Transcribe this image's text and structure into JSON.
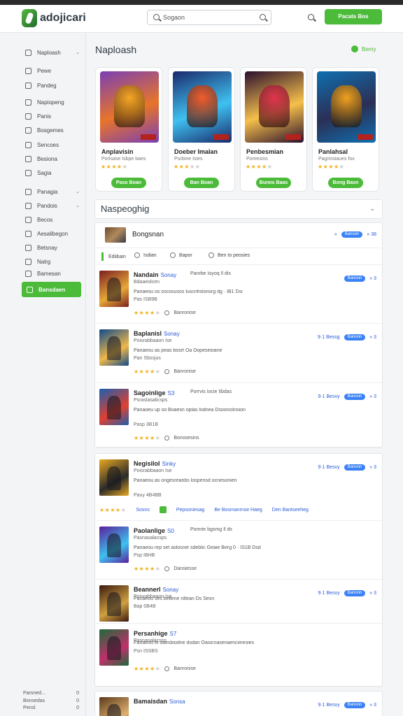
{
  "header": {
    "app_name": "adojicari",
    "search_placeholder": "Sogaon",
    "cta_label": "Pacats Bos"
  },
  "sidebar": {
    "items": [
      {
        "label": "Naploash",
        "chevron": true,
        "top": 0
      },
      {
        "label": "Pewe",
        "chevron": false
      },
      {
        "label": "Pandeg",
        "chevron": false
      },
      {
        "label": "Napiopeng",
        "chevron": false
      },
      {
        "label": "Panis",
        "chevron": false
      },
      {
        "label": "Bosgemes",
        "chevron": false
      },
      {
        "label": "Sencoes",
        "chevron": false
      },
      {
        "label": "Besiona",
        "chevron": false
      },
      {
        "label": "Sagia",
        "chevron": false
      },
      {
        "label": "Panagia",
        "chevron": true
      },
      {
        "label": "Pandois",
        "chevron": true
      },
      {
        "label": "Becos",
        "chevron": false
      },
      {
        "label": "Aesalibegon",
        "chevron": false
      },
      {
        "label": "Betsnay",
        "chevron": false
      },
      {
        "label": "Nalrg",
        "chevron": false
      },
      {
        "label": "Bamesan",
        "chevron": false
      }
    ],
    "active_label": "Bansdaen",
    "footer": [
      {
        "label": "Parsned...",
        "value": "0"
      },
      {
        "label": "Bonsedas",
        "value": "0"
      },
      {
        "label": "Pensl",
        "value": "0"
      }
    ]
  },
  "main": {
    "title": "Naploash",
    "action_label": "Bemy",
    "cards": [
      {
        "title": "Anplavisin",
        "sub": "Porlsase Isbpe baes",
        "rating": 4,
        "button": "Paso Boan",
        "c1": "#7a3fb4",
        "c2": "#f5a623",
        "c3": "#e8742a"
      },
      {
        "title": "Doeber Imalan",
        "sub": "Purbine Isies",
        "rating": 3,
        "button": "Ban Boan",
        "c1": "#1b2a6b",
        "c2": "#f25c2a",
        "c3": "#3ec1f0"
      },
      {
        "title": "Penbesmian",
        "sub": "Pomesins",
        "rating": 4,
        "button": "Bunos Baas",
        "c1": "#2a0f2e",
        "c2": "#e0344c",
        "c3": "#f5c04a"
      },
      {
        "title": "Panlahsal",
        "sub": "Pagrinsiaues fox",
        "rating": 4,
        "button": "Bong Basn",
        "c1": "#0f6fb0",
        "c2": "#f0a020",
        "c3": "#2b2f55"
      }
    ]
  },
  "section": {
    "title": "Naspeoghig"
  },
  "feature": {
    "title": "Bongsnan",
    "link": "»",
    "pill": "Banoon",
    "count": "» 38"
  },
  "tabs": [
    "Ediibain",
    "Isdian",
    "Bapor",
    "Ben to peosies"
  ],
  "rows": [
    {
      "name": "Nandain",
      "tag": "Sonay",
      "extra": "Panrbe Ioyoq Il dis",
      "l2": "Bdaaeolcen",
      "l3": "Panaeou os oscosusos luscrihslonsrg dg · IB1 Dsi",
      "l4": "Pas ISB9B",
      "rating_label": "Banronise",
      "right_label": "",
      "pill": "Banoon",
      "count": "» 3",
      "c1": "#7a1f1f",
      "c2": "#e8a838"
    },
    {
      "name": "Baplanisl",
      "tag": "Sonay",
      "extra": "",
      "l2": "Poisrabbaaon Ise",
      "l3": "Panaeou as peas bosrt Oa Dopeseioane",
      "l4": "Pan Sbssjus",
      "rating_label": "Banronise",
      "right_label": "9·1 Bessg",
      "pill": "Banoon",
      "count": "» 3",
      "c1": "#0f4a8a",
      "c2": "#f0b84a"
    },
    {
      "name": "Sagoinlige",
      "tag": "S3",
      "extra": "Porrvis Iocie Iibdas",
      "l2": "Psraslasalicsps",
      "l3": "Panaoeu up so Boaesn oplas lodnea Dsoonclinsion",
      "l4": "Pasp 3B1B",
      "rating_label": "Bonosesins",
      "right_label": "9·1 Besvy",
      "pill": "Banoon",
      "count": "» 3",
      "c1": "#1a5fb0",
      "c2": "#e04030"
    },
    {
      "name": "Negisilol",
      "tag": "Sinky",
      "extra": "",
      "l2": "Poisrabbaaon Ise",
      "l3": "Panaeou as ongesreanbs lospensd ocnesonien",
      "l4": "Pauy 4B4BB",
      "rating_label": "",
      "right_label": "9·1 Besvy",
      "pill": "Banoon",
      "count": "» 3",
      "c1": "#e8a820",
      "c2": "#2a2a2a"
    },
    {
      "name": "Paolanlige",
      "tag": "S0",
      "extra": "Pomrie bgsmg Il ds",
      "l2": "Pasnasalacsps",
      "l3": "Panaeou rep set aslosnie sdeblic Geaie Berg 0 · IS1B Dsd",
      "l4": "Psp IBHB",
      "rating_label": "Dansiesse",
      "right_label": "",
      "pill": "",
      "count": "",
      "c1": "#5a1f9a",
      "c2": "#3ec1f0"
    },
    {
      "name": "Beannerl",
      "tag": "Sonay",
      "extra": "",
      "l2": "Poisrabbaaon Ise",
      "l3": "Panaeou ses beilene rdlean Ds Sesn",
      "l4": "Bap 0B4B",
      "rating_label": "",
      "right_label": "9·1 Besvy",
      "pill": "Banoon",
      "count": "» 3",
      "c1": "#3a1a10",
      "c2": "#d0a040"
    },
    {
      "name": "Persanhige",
      "tag": "S7",
      "extra": "",
      "l2": "Pasnasalacsps",
      "l3": "Panaeou ei oaesbiodne dsdan Oasicnasenaenciinesies",
      "l4": "Psn ISSBS",
      "rating_label": "Banronise",
      "right_label": "",
      "pill": "",
      "count": "",
      "c1": "#1d6a3a",
      "c2": "#c0306a"
    },
    {
      "name": "Bamaisdan",
      "tag": "Sonsa",
      "extra": "",
      "l2": "",
      "l3": "",
      "l4": "",
      "rating_label": "",
      "right_label": "9·1 Besvy",
      "pill": "Banoon",
      "count": "» 3",
      "c1": "#5a3a1a",
      "c2": "#e0b070"
    }
  ],
  "row_bar": {
    "items": [
      "Pepsoniesag",
      "Be Bosmanrnse Haeg",
      "Den Bantseeheg"
    ],
    "label": "Sosns"
  },
  "colors": {
    "accent": "#4cbb3a",
    "link": "#2a5bd7",
    "pill": "#3b82f6",
    "star": "#f2b01e"
  }
}
